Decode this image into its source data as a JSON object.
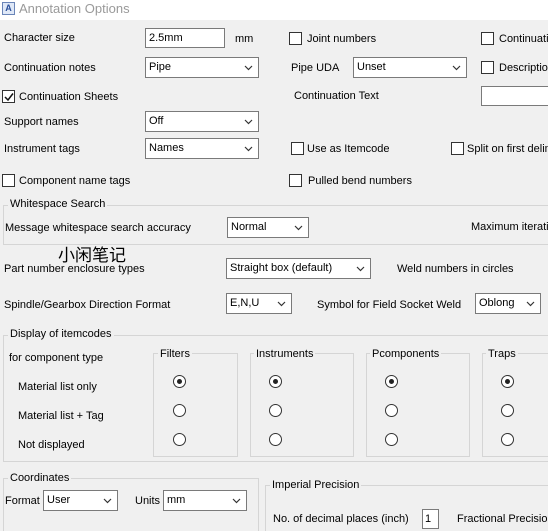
{
  "window": {
    "title": "Annotation Options",
    "icon": "A"
  },
  "general": {
    "character_size_label": "Character size",
    "character_size_value": "2.5mm",
    "character_size_unit": "mm",
    "joint_numbers_label": "Joint numbers",
    "continuation_cut_label": "Continuatio",
    "continuation_notes_label": "Continuation notes",
    "continuation_notes_value": "Pipe",
    "pipe_uda_label": "Pipe UDA",
    "pipe_uda_value": "Unset",
    "description_cut_label": "Descriptio",
    "continuation_sheets_label": "Continuation Sheets",
    "continuation_text_label": "Continuation Text",
    "continuation_text_value": "",
    "support_names_label": "Support names",
    "support_names_value": "Off",
    "instrument_tags_label": "Instrument tags",
    "instrument_tags_value": "Names",
    "use_as_itemcode_label": "Use as Itemcode",
    "split_on_first_label": "Split on first delim",
    "component_name_tags_label": "Component name tags",
    "pulled_bend_numbers_label": "Pulled bend numbers"
  },
  "whitespace": {
    "group_title": "Whitespace Search",
    "accuracy_label": "Message whitespace search accuracy",
    "accuracy_value": "Normal",
    "max_iter_label": "Maximum iterati"
  },
  "watermark_text": "小闲笔记",
  "enclosure": {
    "label": "Part number enclosure types",
    "value": "Straight box (default)",
    "weld_numbers_label": "Weld numbers in circles"
  },
  "spindle": {
    "label": "Spindle/Gearbox Direction Format",
    "value": "E,N,U",
    "field_socket_label": "Symbol for Field Socket Weld",
    "field_socket_value": "Oblong"
  },
  "itemcodes": {
    "group_title": "Display of itemcodes",
    "for_type_label": "for component type",
    "rows": [
      "Material list only",
      "Material list + Tag",
      "Not displayed"
    ],
    "columns": [
      {
        "title": "Filters",
        "selected": 0
      },
      {
        "title": "Instruments",
        "selected": 0
      },
      {
        "title": "Pcomponents",
        "selected": 0
      },
      {
        "title": "Traps",
        "selected": 0
      }
    ]
  },
  "coordinates": {
    "group_title": "Coordinates",
    "format_label": "Format",
    "format_value": "User",
    "units_label": "Units",
    "units_value": "mm"
  },
  "imperial": {
    "group_title": "Imperial Precision",
    "decimal_label": "No. of decimal places (inch)",
    "decimal_value": "1",
    "fractional_label": "Fractional Precisio"
  },
  "checkbox_state": {
    "joint_numbers": false,
    "continuation_cut": false,
    "description_cut": false,
    "continuation_sheets": true,
    "use_as_itemcode": false,
    "split_on_first": false,
    "component_name_tags": false,
    "pulled_bend_numbers": false
  }
}
